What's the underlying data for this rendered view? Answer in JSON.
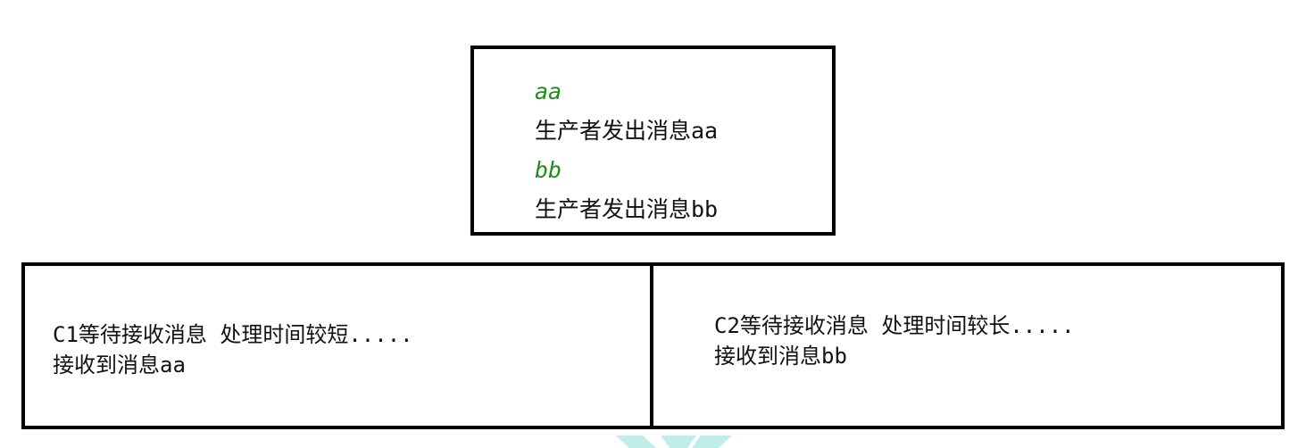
{
  "producer": {
    "line1": "aa",
    "line2": "生产者发出消息aa",
    "line3": "bb",
    "line4": "生产者发出消息bb"
  },
  "consumer1": {
    "line1": "C1等待接收消息 处理时间较短.....",
    "line2": "接收到消息aa"
  },
  "consumer2": {
    "line1": "C2等待接收消息 处理时间较长.....",
    "line2": "接收到消息bb"
  },
  "colors": {
    "message_text": "#1e8c1e",
    "border": "#000000",
    "watermark": "#bfeee8"
  }
}
